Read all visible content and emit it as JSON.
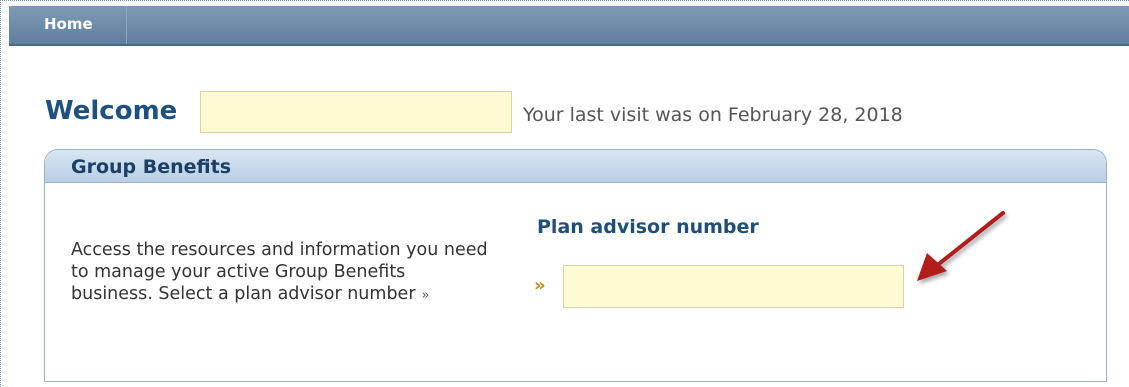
{
  "nav": {
    "home_label": "Home"
  },
  "welcome": {
    "title": "Welcome",
    "name_value": "",
    "last_visit": "Your last visit was on February 28, 2018"
  },
  "group_benefits": {
    "title": "Group Benefits",
    "description": "Access the resources and information you need to manage your active Group Benefits business. Select a plan advisor number",
    "description_arrow": "»",
    "plan_label": "Plan advisor number",
    "plan_arrow": "»",
    "plan_value": ""
  },
  "colors": {
    "nav_bar": "#6d8aa8",
    "title_blue": "#1f5082",
    "field_yellow": "#fdfbd4",
    "annotation_arrow": "#b11a1a"
  },
  "icons": {
    "annotation": "red-arrow-icon",
    "plan_marker": "double-chevron-right-icon"
  }
}
